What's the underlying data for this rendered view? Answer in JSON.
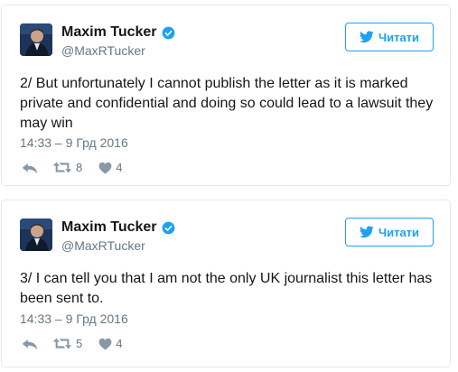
{
  "tweets": [
    {
      "author": {
        "name": "Maxim Tucker",
        "handle": "@MaxRTucker",
        "verified": true
      },
      "follow_label": "Читати",
      "text": "2/ But unfortunately I cannot publish the letter as it is marked private and confidential and doing so could lead to a lawsuit they may win",
      "timestamp": "14:33 – 9 Грд 2016",
      "retweets": "8",
      "likes": "4"
    },
    {
      "author": {
        "name": "Maxim Tucker",
        "handle": "@MaxRTucker",
        "verified": true
      },
      "follow_label": "Читати",
      "text": "3/ I can tell you that I am not the only UK journalist this letter has been sent to.",
      "timestamp": "14:33 – 9 Грд 2016",
      "retweets": "5",
      "likes": "4"
    }
  ],
  "icons": {
    "verified": "verified-badge-icon",
    "follow": "twitter-bird-icon",
    "reply": "reply-icon",
    "retweet": "retweet-icon",
    "like": "heart-icon"
  },
  "colors": {
    "accent": "#1da1f2",
    "muted": "#657786",
    "border": "#e1e8ed"
  }
}
